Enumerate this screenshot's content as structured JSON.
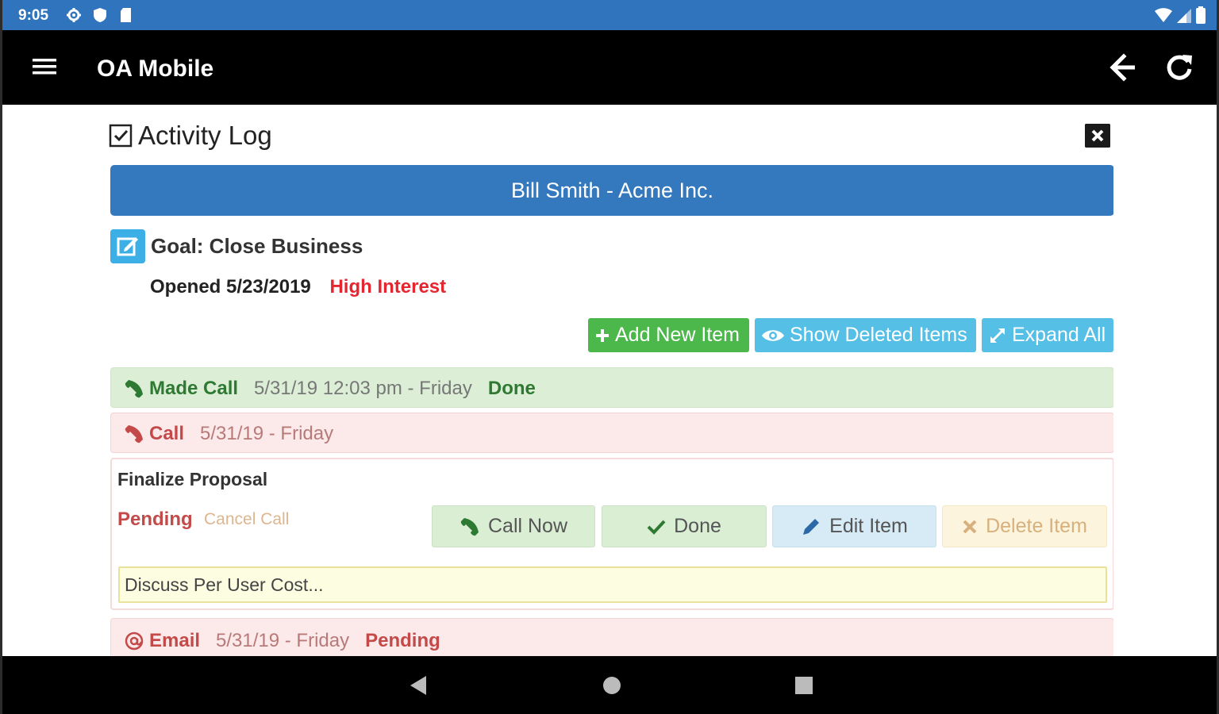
{
  "status_bar": {
    "time": "9:05"
  },
  "app_bar": {
    "title": "OA Mobile"
  },
  "activity_log": {
    "title": "Activity Log",
    "contact": "Bill Smith - Acme Inc.",
    "goal": "Goal: Close Business",
    "opened": "Opened 5/23/2019",
    "interest": "High Interest"
  },
  "actions": {
    "add_new": "Add New Item",
    "show_deleted": "Show Deleted Items",
    "expand_all": "Expand All"
  },
  "items": {
    "made_call": {
      "type": "Made Call",
      "date": "5/31/19 12:03 pm - Friday",
      "status": "Done"
    },
    "call": {
      "type": "Call",
      "date": "5/31/19 - Friday",
      "title": "Finalize Proposal",
      "status": "Pending",
      "cancel": "Cancel Call",
      "buttons": {
        "call_now": "Call Now",
        "done": "Done",
        "edit": "Edit Item",
        "delete": "Delete Item"
      },
      "note": "Discuss Per User Cost..."
    },
    "email": {
      "type": "Email",
      "date": "5/31/19 - Friday",
      "status": "Pending"
    }
  },
  "colors": {
    "status_bar": "#2f74bd",
    "primary": "#3479bd",
    "success": "#4cb84c",
    "info": "#55bfe6",
    "danger": "#e3262f",
    "done_text": "#2f7a33",
    "pending_text": "#c44a49"
  },
  "icons": [
    "settings-icon",
    "shield-icon",
    "sd-card-icon",
    "wifi-icon",
    "signal-icon",
    "battery-icon",
    "menu-icon",
    "back-arrow-icon",
    "refresh-icon",
    "checkbox-icon",
    "close-icon",
    "edit-icon",
    "plus-icon",
    "eye-icon",
    "expand-icon",
    "phone-icon",
    "check-icon",
    "pencil-icon",
    "x-icon",
    "at-icon"
  ]
}
